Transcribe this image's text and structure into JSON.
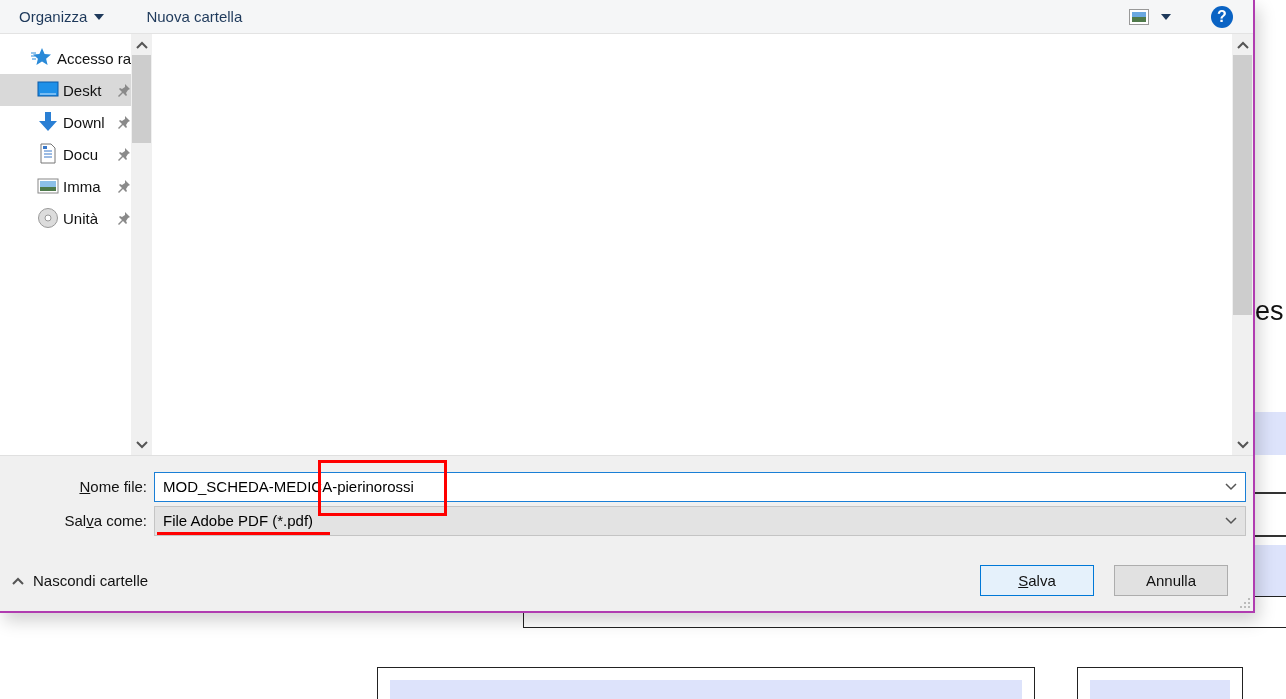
{
  "background_document": {
    "text_fragment": "es"
  },
  "dialog": {
    "toolbar": {
      "organize": "Organizza",
      "new_folder": "Nuova cartella",
      "help": "?"
    },
    "sidebar": {
      "items": [
        {
          "label": "Accesso ra",
          "kind": "quick-access",
          "pinned": false,
          "selected": false
        },
        {
          "label": "Deskt",
          "kind": "desktop",
          "pinned": true,
          "selected": true
        },
        {
          "label": "Downl",
          "kind": "downloads",
          "pinned": true,
          "selected": false
        },
        {
          "label": "Docu",
          "kind": "documents",
          "pinned": true,
          "selected": false
        },
        {
          "label": "Imma",
          "kind": "pictures",
          "pinned": true,
          "selected": false
        },
        {
          "label": "Unità",
          "kind": "drive",
          "pinned": true,
          "selected": false
        }
      ]
    },
    "fields": [
      {
        "kind": "input",
        "label": {
          "key": "N",
          "after": "ome file:"
        },
        "value": "MOD_SCHEDA-MEDICA-pierinorossi"
      },
      {
        "kind": "select",
        "label": {
          "before": "Sal",
          "key": "v",
          "after": "a come:"
        },
        "value": "File Adobe PDF (*.pdf)"
      }
    ],
    "toggle_folders": "Nascondi cartelle",
    "buttons": [
      {
        "label": {
          "key": "S",
          "after": "alva"
        },
        "default": true
      },
      {
        "label": {
          "after": "Annulla"
        },
        "default": false
      }
    ]
  },
  "annotations": [
    {
      "kind": "rectangle"
    },
    {
      "kind": "underline"
    }
  ]
}
